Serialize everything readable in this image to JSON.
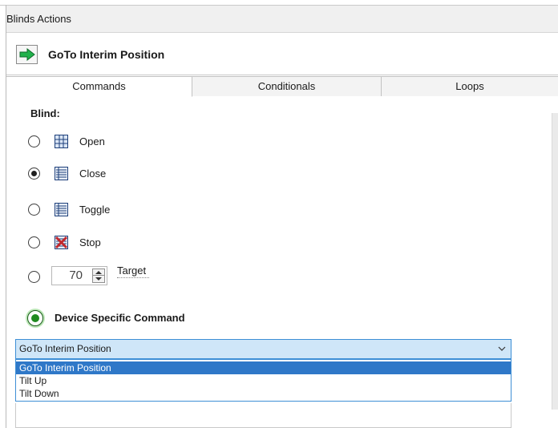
{
  "window": {
    "title": "Blinds Actions"
  },
  "action": {
    "title": "GoTo Interim Position",
    "icon": "green-arrow-icon"
  },
  "tabs": [
    {
      "label": "Commands",
      "active": true
    },
    {
      "label": "Conditionals",
      "active": false
    },
    {
      "label": "Loops",
      "active": false
    }
  ],
  "commands": {
    "section_label": "Blind:",
    "options": [
      {
        "label": "Open",
        "icon": "blind-open-icon",
        "checked": false
      },
      {
        "label": "Close",
        "icon": "blind-closed-icon",
        "checked": true
      },
      {
        "label": "Toggle",
        "icon": "blind-toggle-icon",
        "checked": false
      },
      {
        "label": "Stop",
        "icon": "blind-stop-icon",
        "checked": false
      }
    ],
    "target": {
      "value": "70",
      "label": "Target"
    },
    "device_specific": {
      "label": "Device Specific Command",
      "selected": "GoTo Interim Position",
      "options": [
        "GoTo Interim Position",
        "Tilt Up",
        "Tilt Down"
      ]
    }
  },
  "colors": {
    "accent": "#2f78c8",
    "combo_bg": "#cfe6f8",
    "arrow_green": "#22b14c",
    "stop_red": "#c0282d"
  }
}
